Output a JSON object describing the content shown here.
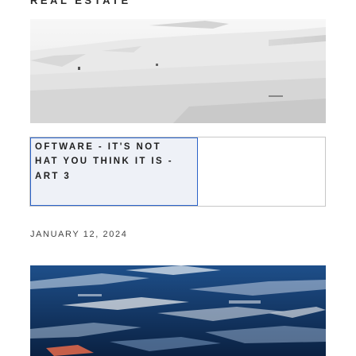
{
  "header": {
    "title_fragment": "REAL ESTATE"
  },
  "featured_post": {
    "title_lines": [
      "OFTWARE - IT'S NOT",
      "HAT YOU THINK IT IS -",
      "ART 3"
    ],
    "date": "JANUARY 12, 2024"
  },
  "colors": {
    "focus_border": "#2b63c9",
    "card_border": "#c7c7c7",
    "text": "#1f1f1f"
  }
}
